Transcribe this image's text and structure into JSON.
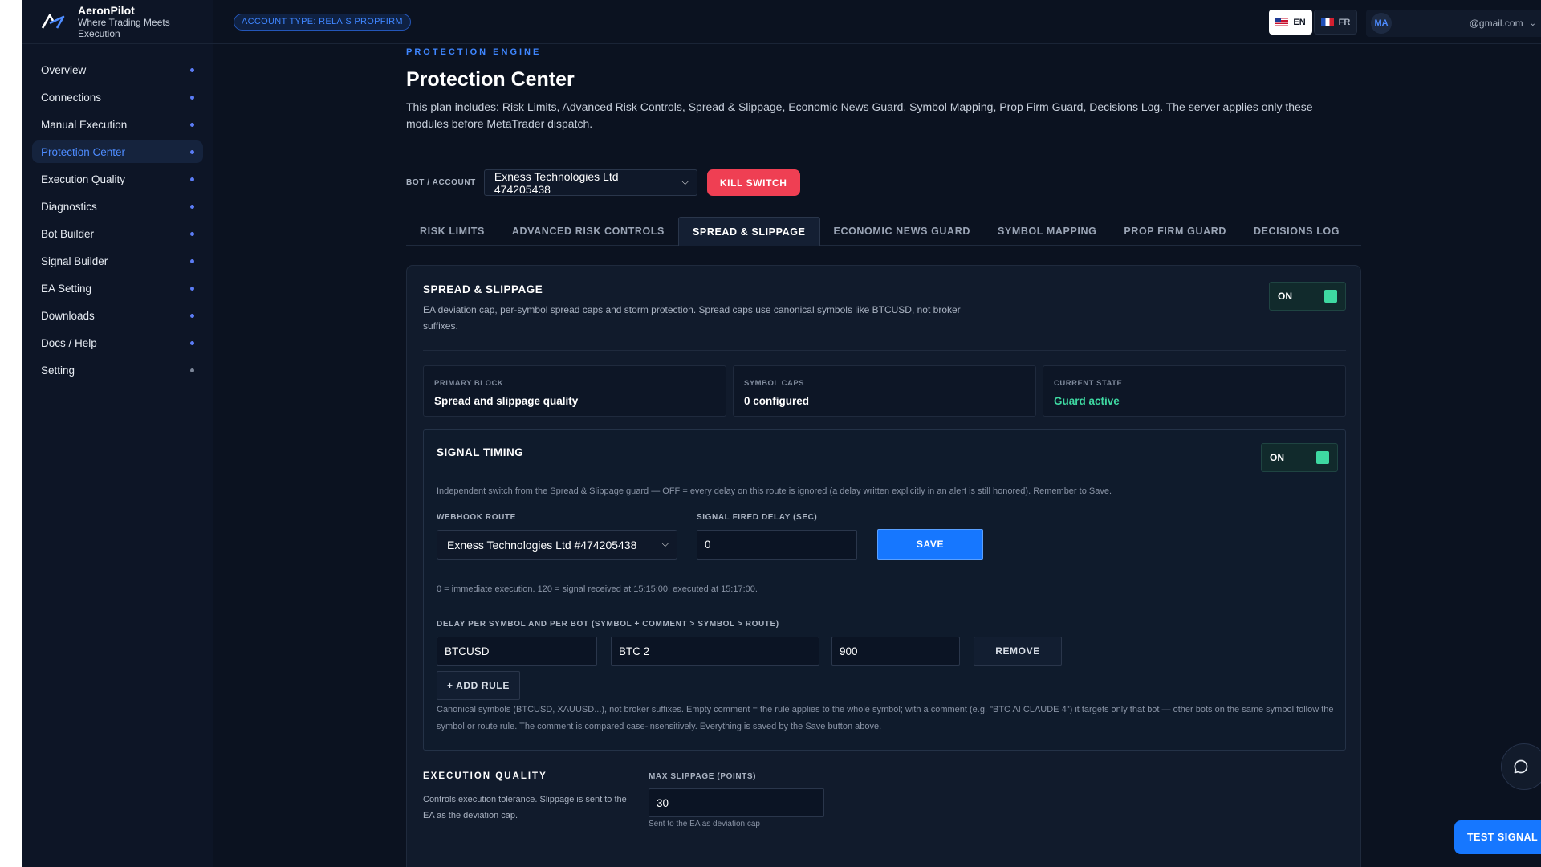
{
  "brand": {
    "name": "AeronPilot",
    "tagline": "Where Trading Meets Execution",
    "logo_icon": "aeronpilot-logo-icon"
  },
  "sidebar": {
    "items": [
      {
        "label": "Overview"
      },
      {
        "label": "Connections"
      },
      {
        "label": "Manual Execution"
      },
      {
        "label": "Protection Center",
        "active": true
      },
      {
        "label": "Execution Quality"
      },
      {
        "label": "Diagnostics"
      },
      {
        "label": "Bot Builder"
      },
      {
        "label": "Signal Builder"
      },
      {
        "label": "EA Setting"
      },
      {
        "label": "Downloads"
      },
      {
        "label": "Docs / Help"
      },
      {
        "label": "Setting"
      }
    ]
  },
  "topbar": {
    "account_badge": "ACCOUNT TYPE: RELAIS PROPFIRM",
    "lang_en": "EN",
    "lang_fr": "FR",
    "avatar": "MA",
    "email": "@gmail.com"
  },
  "header": {
    "eyebrow": "PROTECTION ENGINE",
    "title": "Protection Center",
    "description": "This plan includes: Risk Limits, Advanced Risk Controls, Spread & Slippage, Economic News Guard, Symbol Mapping, Prop Firm Guard, Decisions Log. The server applies only these modules before MetaTrader dispatch."
  },
  "bot_select": {
    "label": "BOT / ACCOUNT",
    "value": "Exness Technologies Ltd 474205438"
  },
  "kill_switch": "KILL SWITCH",
  "tabs": [
    {
      "label": "RISK LIMITS"
    },
    {
      "label": "ADVANCED RISK CONTROLS"
    },
    {
      "label": "SPREAD & SLIPPAGE",
      "active": true
    },
    {
      "label": "ECONOMIC NEWS GUARD"
    },
    {
      "label": "SYMBOL MAPPING"
    },
    {
      "label": "PROP FIRM GUARD"
    },
    {
      "label": "DECISIONS LOG"
    }
  ],
  "spread": {
    "title": "SPREAD & SLIPPAGE",
    "description": "EA deviation cap, per-symbol spread caps and storm protection. Spread caps use canonical symbols like BTCUSD, not broker suffixes.",
    "toggle": "ON",
    "stats": [
      {
        "label": "PRIMARY BLOCK",
        "value": "Spread and slippage quality"
      },
      {
        "label": "SYMBOL CAPS",
        "value": "0 configured"
      },
      {
        "label": "CURRENT STATE",
        "value": "Guard active"
      }
    ]
  },
  "timing": {
    "title": "SIGNAL TIMING",
    "toggle": "ON",
    "description": "Independent switch from the Spread & Slippage guard — OFF = every delay on this route is ignored (a delay written explicitly in an alert is still honored). Remember to Save.",
    "route_label": "WEBHOOK ROUTE",
    "route_value": "Exness Technologies Ltd #474205438",
    "delay_label": "SIGNAL FIRED DELAY (SEC)",
    "delay_value": "0",
    "save": "SAVE",
    "delay_help": "0 = immediate execution. 120 = signal received at 15:15:00, executed at 15:17:00.",
    "rules_label": "DELAY PER SYMBOL AND PER BOT (SYMBOL + COMMENT > SYMBOL > ROUTE)",
    "rule": {
      "symbol": "BTCUSD",
      "comment": "BTC 2",
      "delay": "900"
    },
    "remove": "REMOVE",
    "add_rule": "+ ADD RULE",
    "footnote": "Canonical symbols (BTCUSD, XAUUSD...), not broker suffixes. Empty comment = the rule applies to the whole symbol; with a comment (e.g. \"BTC AI CLAUDE 4\") it targets only that bot — other bots on the same symbol follow the symbol or route rule. The comment is compared case-insensitively. Everything is saved by the Save button above."
  },
  "execution_quality": {
    "title": "EXECUTION QUALITY",
    "description": "Controls execution tolerance. Slippage is sent to the EA as the deviation cap.",
    "slippage_label": "MAX SLIPPAGE (POINTS)",
    "slippage_value": "30",
    "slippage_help": "Sent to the EA as deviation cap"
  },
  "floating": {
    "test_signal": "TEST SIGNAL",
    "chat_icon": "chat-bubble-icon"
  },
  "colors": {
    "accent": "#1677ff",
    "danger": "#ef3f53",
    "success": "#3ed8a1",
    "background": "#0b1220"
  }
}
